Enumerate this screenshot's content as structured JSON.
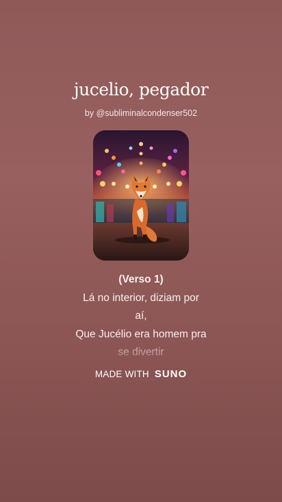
{
  "song": {
    "title": "jucelio, pegador",
    "byline": "by @subliminalcondenser502"
  },
  "cover": {
    "icon": "fox-on-stage-cover-art"
  },
  "lyrics": {
    "lines": [
      "(Verso 1)",
      "Lá no interior, diziam por",
      "aí,",
      "Que Jucélio era homem pra",
      "se divertir"
    ]
  },
  "footer": {
    "made_with": "MADE WITH",
    "brand": "SUNO"
  },
  "colors": {
    "background": "#8e5a58",
    "text": "#ffffff"
  }
}
